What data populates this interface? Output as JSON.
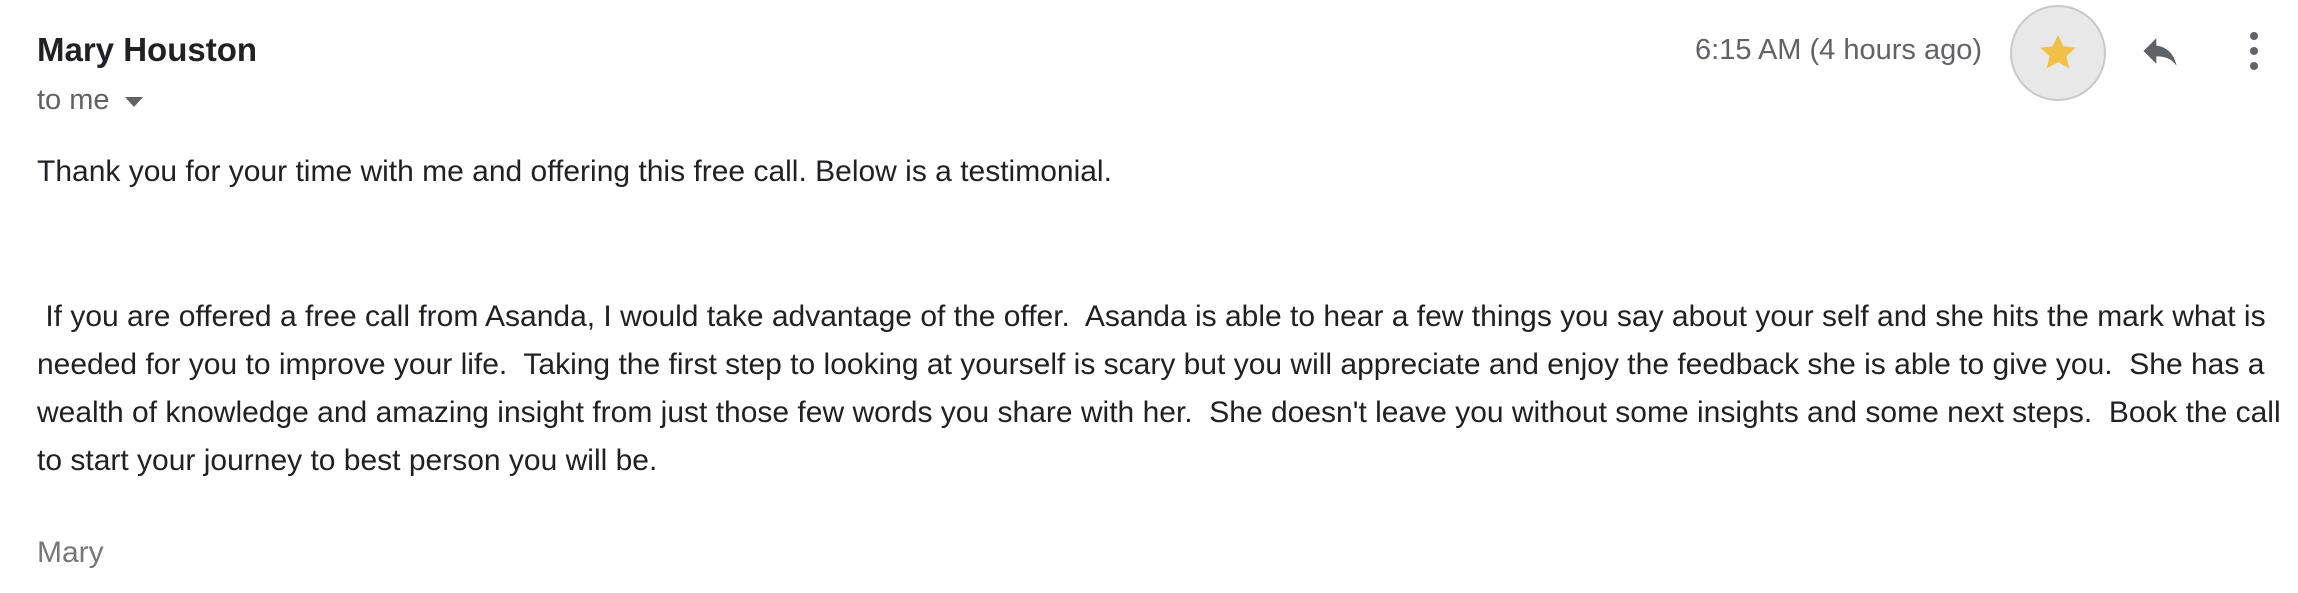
{
  "email": {
    "sender_name": "Mary Houston",
    "recipient_label": "to me",
    "timestamp": "6:15 AM (4 hours ago)",
    "actions": {
      "star_icon": "star-icon",
      "reply_icon": "reply-icon",
      "more_icon": "more-vertical-icon"
    },
    "body": {
      "intro": "Thank you for your time with me and offering this free call. Below is a testimonial.",
      "testimonial": " If you are offered a free call from Asanda, I would take advantage of the offer.  Asanda is able to hear a few things you say about your self and she hits the mark what is needed for you to improve your life.  Taking the first step to looking at yourself is scary but you will appreciate and enjoy the feedback she is able to give you.  She has a wealth of knowledge and amazing insight from just those few words you share with her.  She doesn't leave you without some insights and some next steps.  Book the call to start your journey to best person you will be.",
      "signature": "Mary"
    }
  },
  "colors": {
    "star": "#f2c045",
    "icon_gray": "#5f6368",
    "text": "#202124",
    "signature_gray": "#777777"
  }
}
